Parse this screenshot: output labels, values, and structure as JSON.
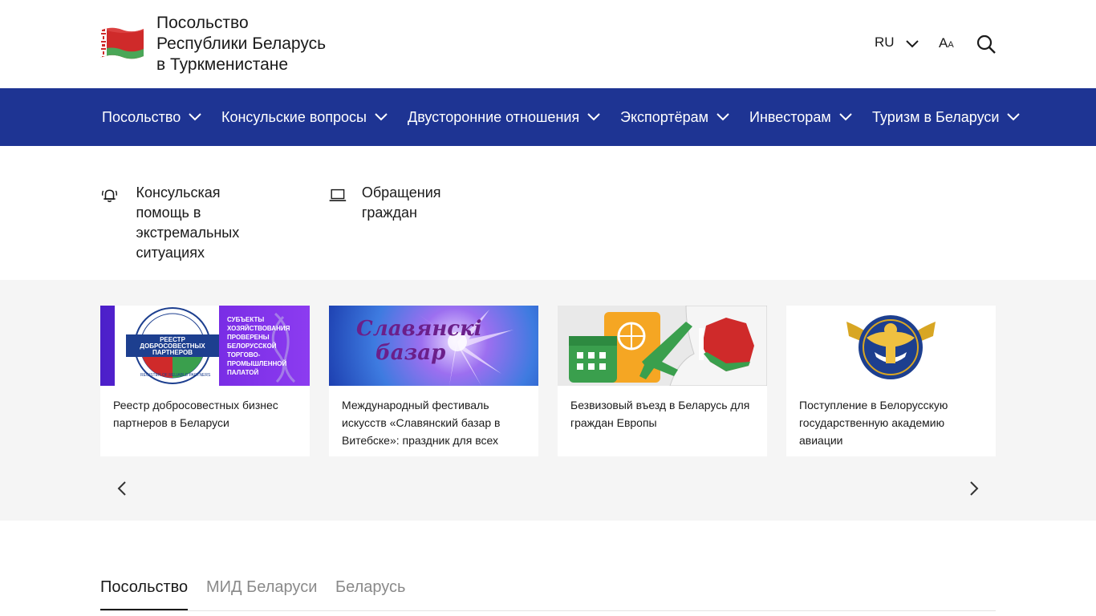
{
  "header": {
    "title_lines": [
      "Посольство",
      "Республики Беларусь",
      "в Туркменистане"
    ],
    "lang": "RU",
    "font_size_big": "A",
    "font_size_small": "A"
  },
  "colors": {
    "nav_bg": "#1e3493",
    "flag_red": "#cf2a2a",
    "flag_green": "#4aa657"
  },
  "nav": {
    "items": [
      {
        "label": "Посольство"
      },
      {
        "label": "Консульские вопросы"
      },
      {
        "label": "Двусторонние отношения"
      },
      {
        "label": "Экспортёрам"
      },
      {
        "label": "Инвесторам"
      },
      {
        "label": "Туризм в Беларуси"
      }
    ]
  },
  "quick_links": [
    {
      "lines": [
        "Консульская помощь в",
        "экстремальных",
        "ситуациях"
      ],
      "icon": "alarm-bell-icon"
    },
    {
      "lines": [
        "Обращения граждан"
      ],
      "icon": "laptop-icon"
    }
  ],
  "carousel": {
    "cards": [
      {
        "lines": [
          "Реестр добросовестных бизнес",
          "партнеров в Беларуси"
        ],
        "img_text_left": [
          "РЕЕСТР",
          "ДОБРОСОВЕСТНЫХ",
          "ПАРТНЕРОВ"
        ],
        "img_text_right": [
          "СУБЪЕКТЫ",
          "ХОЗЯЙСТВОВАНИЯ",
          "ПРОВЕРЕНЫ",
          "БЕЛОРУССКОЙ",
          "ТОРГОВО-",
          "ПРОМЫШЛЕННОЙ",
          "ПАЛАТОЙ"
        ],
        "img_ring_text": "REGISTER OF RELIABLE PARTNERS"
      },
      {
        "lines": [
          "Международный фестиваль",
          "искусств «Славянский базар в",
          "Витебске»: праздник для всех"
        ],
        "img_text": [
          "Славянскі",
          "базар"
        ]
      },
      {
        "lines": [
          "Безвизовый въезд в Беларусь для",
          "граждан Европы"
        ]
      },
      {
        "lines": [
          "Поступление в Белорусскую",
          "государственную академию",
          "авиации"
        ]
      }
    ]
  },
  "tabs": [
    {
      "label": "Посольство",
      "active": true
    },
    {
      "label": "МИД Беларуси",
      "active": false
    },
    {
      "label": "Беларусь",
      "active": false
    }
  ]
}
